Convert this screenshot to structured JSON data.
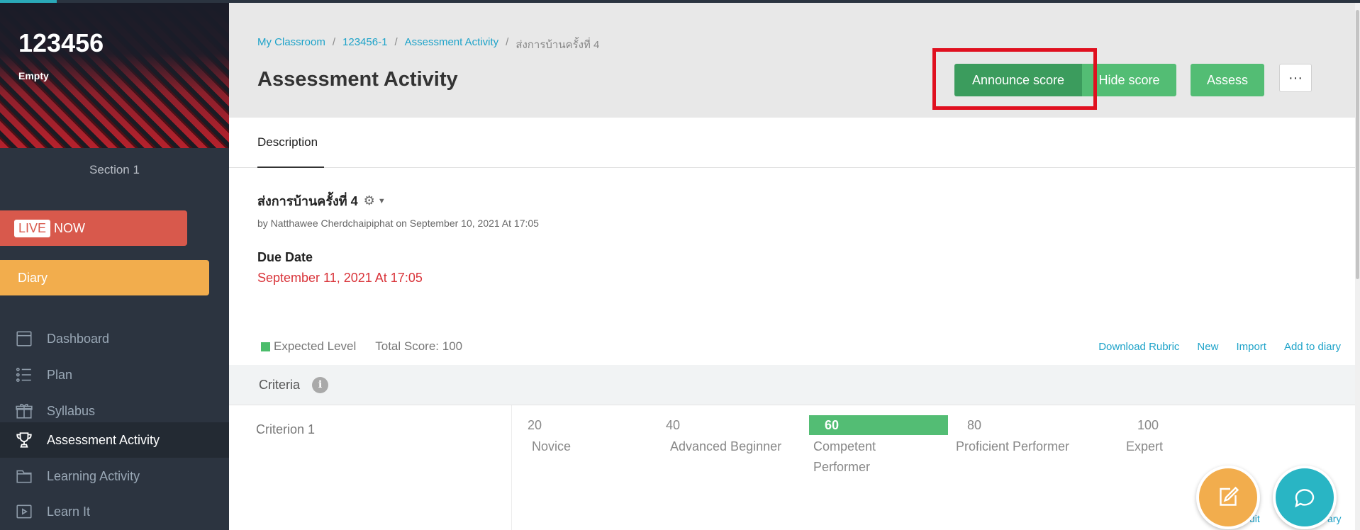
{
  "sidebar": {
    "class_name": "123456",
    "class_status": "Empty",
    "section": "Section 1",
    "live": {
      "badge": "LIVE",
      "label": "NOW"
    },
    "diary": "Diary",
    "items": [
      {
        "label": "Dashboard",
        "icon": "dashboard-icon"
      },
      {
        "label": "Plan",
        "icon": "list-icon"
      },
      {
        "label": "Syllabus",
        "icon": "gift-icon"
      },
      {
        "label": "Assessment Activity",
        "icon": "trophy-icon",
        "active": true
      },
      {
        "label": "Learning Activity",
        "icon": "folder-icon"
      },
      {
        "label": "Learn It",
        "icon": "play-icon"
      }
    ]
  },
  "header": {
    "breadcrumb": [
      {
        "label": "My Classroom",
        "sep": "/"
      },
      {
        "label": "123456-1",
        "sep": "/"
      },
      {
        "label": "Assessment Activity",
        "sep": "/"
      },
      {
        "label": "ส่งการบ้านครั้งที่ 4"
      }
    ],
    "title": "Assessment Activity",
    "buttons": {
      "announce": "Announce score",
      "hide": "Hide score",
      "assess": "Assess",
      "more": "···"
    }
  },
  "tabs": [
    {
      "label": "Description",
      "active": true
    }
  ],
  "activity": {
    "title": "ส่งการบ้านครั้งที่ 4",
    "byline": "by Natthawee Cherdchaipiphat on September 10, 2021 At 17:05",
    "due_label": "Due Date",
    "due_value": "September 11, 2021 At 17:05"
  },
  "rubric": {
    "legend": "Expected Level",
    "total": "Total Score: 100",
    "links": [
      "Download Rubric",
      "New",
      "Import",
      "Add to diary"
    ],
    "criteria_header": "Criteria",
    "info_icon": "i",
    "criteria": [
      {
        "name": "Criterion 1",
        "levels": [
          {
            "score": "20",
            "label": "Novice"
          },
          {
            "score": "40",
            "label": "Advanced Beginner"
          },
          {
            "score": "60",
            "label": "Competent Performer",
            "expected": true
          },
          {
            "score": "80",
            "label": "Proficient Performer"
          },
          {
            "score": "100",
            "label": "Expert"
          }
        ]
      }
    ]
  },
  "peek_text": {
    "left": "dit",
    "right": "ary"
  },
  "colors": {
    "accent_green": "#53bd74",
    "dark_green": "#3b9c5d",
    "highlight_red": "#e0101f",
    "link_blue": "#1ea3c9",
    "due_red": "#d9343a",
    "live_red": "#d8594c",
    "diary_orange": "#f2ad4d",
    "sidebar_bg": "#2c3440",
    "chat_teal": "#29b5c4"
  }
}
